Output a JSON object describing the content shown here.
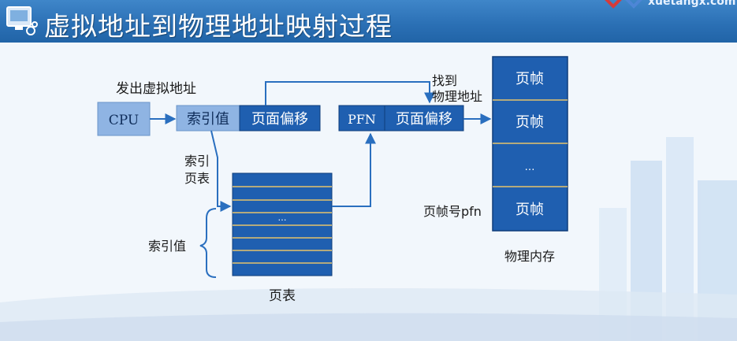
{
  "title": "虚拟地址到物理地址映射过程",
  "brand": "xuetangx.com",
  "icons": {
    "title": "slide-title-icon",
    "brand": "xuetangx-logo-icon"
  },
  "colors": {
    "box_blue": "#1f5fb0",
    "box_border": "#0f3d7a",
    "arrow": "#2a6fbf",
    "cpu_box": "#8fb4e3",
    "index_box": "#8fb4e3",
    "title_bar": "#2a6fb4"
  },
  "diagram": {
    "issue_label": "发出虚拟地址",
    "cpu": "CPU",
    "virtual_addr": {
      "index": "索引值",
      "offset": "页面偏移"
    },
    "index_pt_label_1": "索引",
    "index_pt_label_2": "页表",
    "page_table_dots": "…",
    "page_table_label": "页表",
    "index_brace_label": "索引值",
    "physical_addr": {
      "pfn": "PFN",
      "offset": "页面偏移"
    },
    "find_label_1": "找到",
    "find_label_2": "物理地址",
    "memory": [
      "页帧",
      "页帧",
      "…",
      "页帧"
    ],
    "pfn_label": "页帧号pfn",
    "memory_label": "物理内存"
  }
}
